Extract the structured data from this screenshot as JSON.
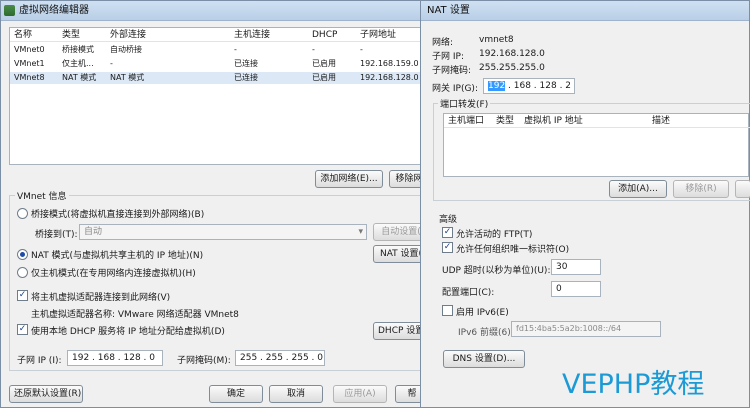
{
  "vne": {
    "title": "虚拟网络编辑器",
    "columns": [
      "名称",
      "类型",
      "外部连接",
      "主机连接",
      "DHCP",
      "子网地址"
    ],
    "rows": [
      [
        "VMnet0",
        "桥接模式",
        "自动桥接",
        "-",
        "-",
        "-"
      ],
      [
        "VMnet1",
        "仅主机...",
        "-",
        "已连接",
        "已启用",
        "192.168.159.0"
      ],
      [
        "VMnet8",
        "NAT 模式",
        "NAT 模式",
        "已连接",
        "已启用",
        "192.168.128.0"
      ]
    ],
    "add_network": "添加网络(E)...",
    "remove_network": "移除网",
    "info_label": "VMnet 信息",
    "bridge_mode": "桥接模式(将虚拟机直接连接到外部网络)(B)",
    "bridge_to_label": "桥接到(T):",
    "bridge_to_value": "自动",
    "auto_settings": "自动设置(",
    "nat_mode": "NAT 模式(与虚拟机共享主机的 IP 地址)(N)",
    "nat_settings": "NAT 设置(",
    "host_only_mode": "仅主机模式(在专用网络内连接虚拟机)(H)",
    "connect_adapter": "将主机虚拟适配器连接到此网络(V)",
    "adapter_name": "主机虚拟适配器名称: VMware 网络适配器 VMnet8",
    "use_dhcp": "使用本地 DHCP 服务将 IP 地址分配给虚拟机(D)",
    "dhcp_settings": "DHCP 设置",
    "subnet_ip_label": "子网 IP (I):",
    "subnet_ip_value": "192 . 168 . 128 . 0",
    "subnet_mask_label": "子网掩码(M):",
    "subnet_mask_value": "255 . 255 . 255 . 0",
    "restore_defaults": "还原默认设置(R)",
    "ok": "确定",
    "cancel": "取消",
    "apply": "应用(A)",
    "help": "帮"
  },
  "nat": {
    "title": "NAT 设置",
    "network_label": "网络:",
    "network_value": "vmnet8",
    "subnet_ip_label": "子网 IP:",
    "subnet_ip_value": "192.168.128.0",
    "subnet_mask_label": "子网掩码:",
    "subnet_mask_value": "255.255.255.0",
    "gateway_label": "网关 IP(G):",
    "gateway_first_octet": "192",
    "gateway_rest": " . 168 . 128 .  2",
    "port_forward_label": "端口转发(F)",
    "pf_columns": [
      "主机端口",
      "类型",
      "虚拟机 IP 地址",
      "描述"
    ],
    "add": "添加(A)...",
    "remove": "移除(R)",
    "advanced_label": "高级",
    "allow_ftp": "允许活动的 FTP(T)",
    "allow_any_oui": "允许任何组织唯一标识符(O)",
    "udp_timeout_label": "UDP 超时(以秒为单位)(U):",
    "udp_timeout_value": "30",
    "config_port_label": "配置端口(C):",
    "config_port_value": "0",
    "enable_ipv6": "启用 IPv6(E)",
    "ipv6_prefix_label": "IPv6 前缀(6):",
    "ipv6_prefix_value": "fd15:4ba5:5a2b:1008::/64",
    "dns_settings": "DNS 设置(D)..."
  },
  "watermark": "VEPHP教程",
  "colors": {
    "selection": "#dce8f6",
    "watermark": "#1c9ad6",
    "highlight": "#3399ff"
  }
}
